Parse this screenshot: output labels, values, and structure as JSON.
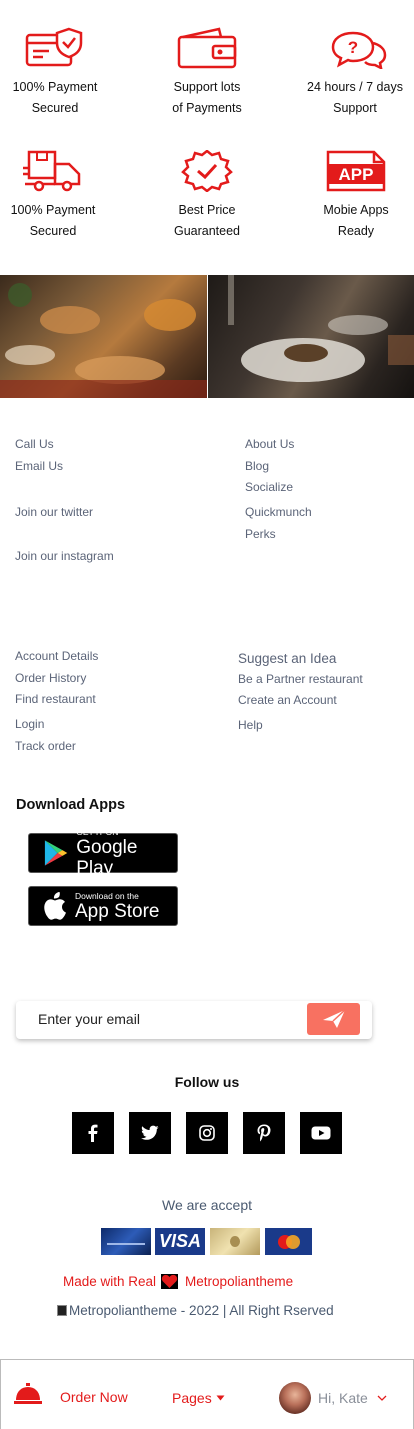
{
  "features": [
    {
      "icon": "payment-secure-card-icon",
      "label": "100% Payment\nSecured"
    },
    {
      "icon": "wallet-icon",
      "label": "Support lots\nof Payments"
    },
    {
      "icon": "support-chat-icon",
      "label": "24 hours / 7 days\nSupport"
    },
    {
      "icon": "delivery-truck-icon",
      "label": "100% Payment\nSecured"
    },
    {
      "icon": "best-price-badge-icon",
      "label": "Best Price\nGuaranteed"
    },
    {
      "icon": "app-ready-icon",
      "label": "Mobie Apps\nReady",
      "icon_text": "APP"
    }
  ],
  "links_group1": {
    "left": [
      "Call Us",
      "Email Us",
      "Join our twitter",
      "Join our instagram"
    ],
    "right": [
      "About Us",
      "Blog",
      "Socialize",
      "Quickmunch",
      "Perks"
    ]
  },
  "links_group2": {
    "left": [
      "Account Details",
      "Order History",
      "Find restaurant",
      "Login",
      "Track order"
    ],
    "right": [
      "Suggest an Idea",
      "Be a Partner restaurant",
      "Create an Account",
      "Help"
    ]
  },
  "download": {
    "title": "Download Apps",
    "google_small": "GET IT ON",
    "google_big": "Google Play",
    "apple_small": "Download on the",
    "apple_big": "App Store"
  },
  "newsletter": {
    "placeholder": "Enter your email"
  },
  "follow": {
    "title": "Follow us",
    "icons": [
      "facebook-icon",
      "twitter-icon",
      "instagram-icon",
      "pinterest-icon",
      "youtube-icon"
    ]
  },
  "accept": {
    "title": "We are accept",
    "cards": [
      "card-1",
      "visa-card",
      "amex-gold-card",
      "mastercard"
    ],
    "visa_text": "VISA"
  },
  "made_with": {
    "prefix": "Made with Real",
    "brand": "Metropoliantheme"
  },
  "copyright": "Metropoliantheme - 2022 | All Right Rserved",
  "bottom_bar": {
    "order_now": "Order Now",
    "pages": "Pages",
    "greeting": "Hi, Kate"
  },
  "colors": {
    "accent": "#e31b1b",
    "send_button": "#f87161",
    "link_text": "#5b6478"
  }
}
